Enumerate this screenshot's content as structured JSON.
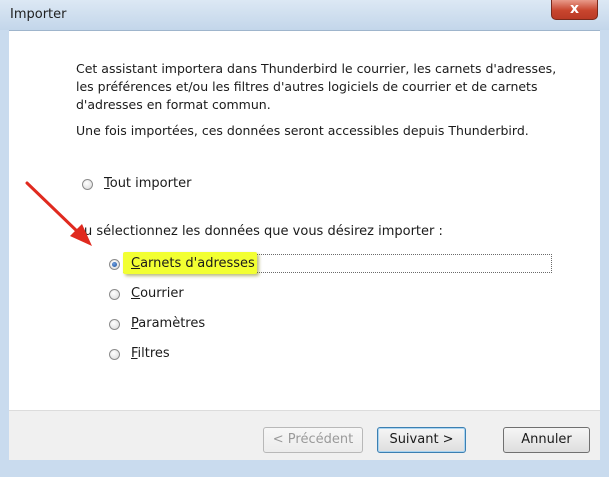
{
  "window": {
    "title": "Importer",
    "close_glyph": "x"
  },
  "content": {
    "intro": "Cet assistant importera dans Thunderbird le courrier, les carnets d'adresses, les préférences et/ou les filtres d'autres logiciels de courrier et de carnets d'adresses en format commun.",
    "info": "Une fois importées, ces données seront accessibles depuis Thunderbird.",
    "import_all": {
      "accel": "T",
      "rest": "out importer",
      "selected": false
    },
    "prompt": "ou sélectionnez les données que vous désirez importer :",
    "options": [
      {
        "accel": "C",
        "rest": "arnets d'adresses",
        "selected": true
      },
      {
        "accel": "C",
        "rest": "ourrier",
        "selected": false
      },
      {
        "accel": "P",
        "rest": "aramètres",
        "selected": false
      },
      {
        "accel": "F",
        "rest": "iltres",
        "selected": false
      }
    ]
  },
  "buttons": {
    "previous": "< Précédent",
    "next": "Suivant >",
    "cancel": "Annuler"
  },
  "colors": {
    "annotation_arrow": "#e02a1f",
    "highlight": "#f2ff32"
  },
  "icons": {
    "close": "close-icon",
    "radio": "radio-icon",
    "annotation": "red-arrow-icon"
  }
}
